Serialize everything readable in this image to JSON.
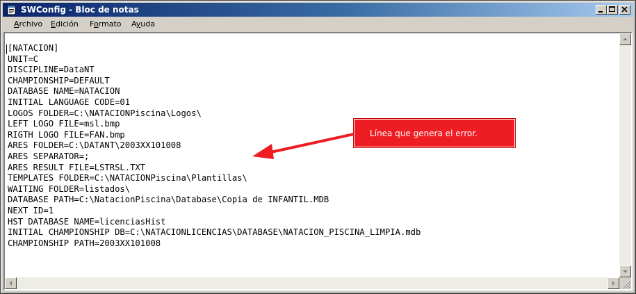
{
  "window": {
    "title": "SWConfig - Bloc de notas",
    "app_icon": "notepad-icon",
    "controls": [
      "minimize-icon",
      "maximize-icon",
      "close-icon"
    ]
  },
  "menu": {
    "items": [
      {
        "label": "Archivo",
        "accel": "A"
      },
      {
        "label": "Edición",
        "accel": "E"
      },
      {
        "label": "Formato",
        "accel": "o"
      },
      {
        "label": "Ayuda",
        "accel": "y"
      }
    ]
  },
  "editor": {
    "lines": [
      "[NATACION]",
      "UNIT=C",
      "DISCIPLINE=DataNT",
      "CHAMPIONSHIP=DEFAULT",
      "DATABASE NAME=NATACION",
      "INITIAL LANGUAGE CODE=01",
      "LOGOS FOLDER=C:\\NATACIONPiscina\\Logos\\",
      "LEFT LOGO FILE=msl.bmp",
      "RIGTH LOGO FILE=FAN.bmp",
      "ARES FOLDER=C:\\DATANT\\2003XX101008",
      "ARES SEPARATOR=;",
      "ARES RESULT FILE=LSTRSL.TXT",
      "TEMPLATES FOLDER=C:\\NATACIONPiscina\\Plantillas\\",
      "WAITING FOLDER=listados\\",
      "DATABASE PATH=C:\\NatacionPiscina\\Database\\Copia de INFANTIL.MDB",
      "NEXT ID=1",
      "HST DATABASE NAME=licenciasHist",
      "INITIAL CHAMPIONSHIP DB=C:\\NATACIONLICENCIAS\\DATABASE\\NATACION_PISCINA_LIMPIA.mdb",
      "CHAMPIONSHIP PATH=2003XX101008"
    ]
  },
  "annotation": {
    "text": "Línea que genera el error.",
    "color": "#ee1c23"
  },
  "colors": {
    "titlebar_start": "#0a246a",
    "titlebar_end": "#a6caf0",
    "chrome": "#d4d0c8"
  }
}
